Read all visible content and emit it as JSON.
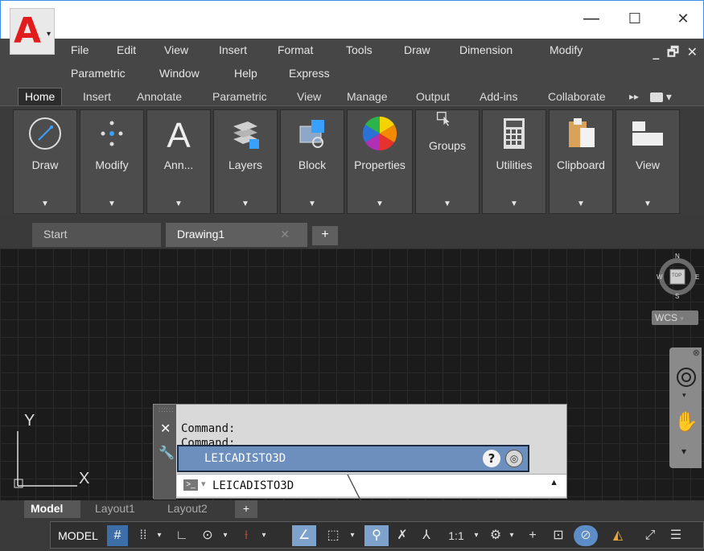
{
  "window": {
    "minimize": "—",
    "maximize": "☐",
    "close": "✕",
    "doc_controls": "_ 🗗 ✕"
  },
  "menu": {
    "row1": [
      "File",
      "Edit",
      "View",
      "Insert",
      "Format",
      "Tools",
      "Draw",
      "Dimension",
      "Modify"
    ],
    "row2": [
      "Parametric",
      "Window",
      "Help",
      "Express"
    ]
  },
  "ribbon_tabs": [
    "Home",
    "Insert",
    "Annotate",
    "Parametric",
    "View",
    "Manage",
    "Output",
    "Add-ins",
    "Collaborate"
  ],
  "ribbon_panels": [
    {
      "label": "Draw",
      "icon": "draw-icon"
    },
    {
      "label": "Modify",
      "icon": "modify-icon"
    },
    {
      "label": "Ann...",
      "icon": "annotation-icon"
    },
    {
      "label": "Layers",
      "icon": "layers-icon"
    },
    {
      "label": "Block",
      "icon": "block-icon"
    },
    {
      "label": "Properties",
      "icon": "properties-icon"
    },
    {
      "label": "Groups",
      "icon": "groups-icon"
    },
    {
      "label": "Utilities",
      "icon": "utilities-icon"
    },
    {
      "label": "Clipboard",
      "icon": "clipboard-icon"
    },
    {
      "label": "View",
      "icon": "view-icon"
    }
  ],
  "file_tabs": {
    "start": "Start",
    "drawing": "Drawing1",
    "close": "✕",
    "new": "+"
  },
  "viewcube": {
    "north": "N",
    "south": "S",
    "east": "E",
    "west": "W",
    "top": "TOP",
    "wcs": "WCS"
  },
  "ucs": {
    "x": "X",
    "y": "Y"
  },
  "command": {
    "history_line1": "Command:",
    "history_line2": "Command:",
    "suggestion": "LEICADISTO3D",
    "input_value": "LEICADISTO3D"
  },
  "layout_tabs": [
    "Model",
    "Layout1",
    "Layout2",
    "+"
  ],
  "status": {
    "model": "MODEL",
    "scale": "1:1"
  },
  "colors": {
    "accent": "#3d6ea8",
    "logo": "#e21c1c",
    "canvas": "#1b1b1b"
  }
}
